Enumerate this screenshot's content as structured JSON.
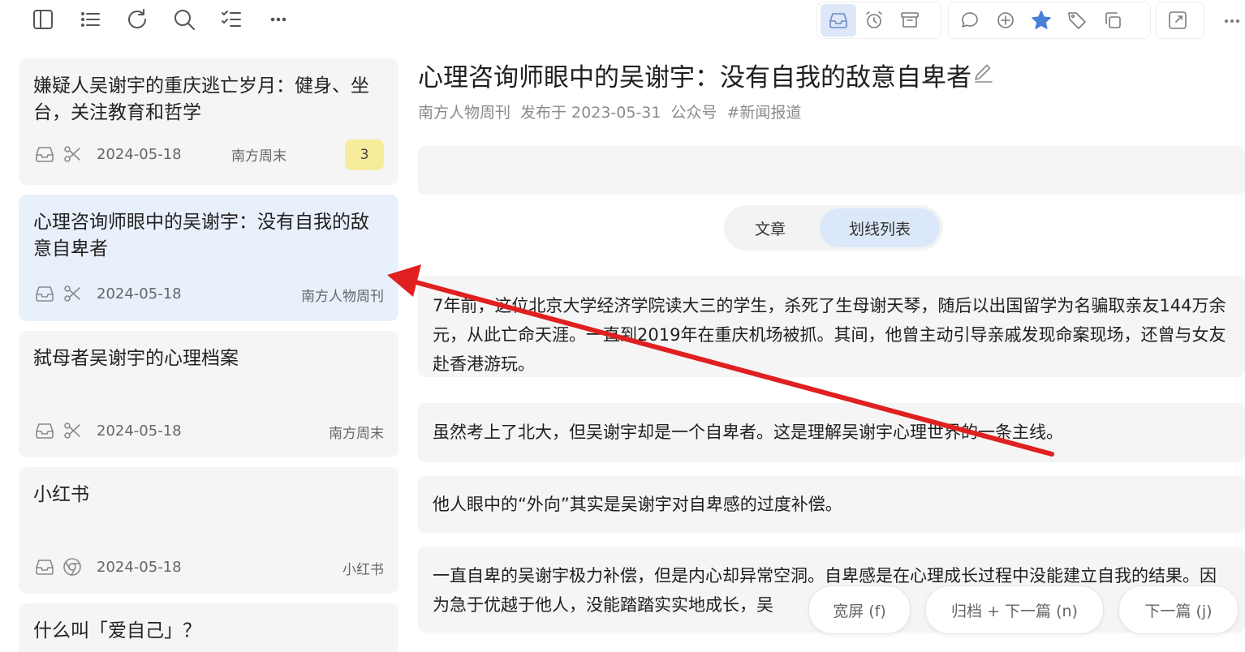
{
  "list": {
    "cards": [
      {
        "title": "嫌疑人吴谢宇的重庆逃亡岁月：健身、坐台，关注教育和哲学",
        "date": "2024-05-18",
        "source": "南方周末",
        "badge": "3",
        "icon2": "scissors-icon"
      },
      {
        "title": "心理咨询师眼中的吴谢宇：没有自我的敌意自卑者",
        "date": "2024-05-18",
        "source": "南方人物周刊",
        "icon2": "scissors-icon"
      },
      {
        "title": "弑母者吴谢宇的心理档案",
        "date": "2024-05-18",
        "source": "南方周末",
        "icon2": "scissors-icon"
      },
      {
        "title": "小红书",
        "date": "2024-05-18",
        "source": "小红书",
        "icon2": "chrome-icon"
      },
      {
        "title": "什么叫「爱自己」？"
      }
    ]
  },
  "article": {
    "title": "心理咨询师眼中的吴谢宇：没有自我的敌意自卑者",
    "meta": {
      "source": "南方人物周刊",
      "published": "发布于 2023-05-31",
      "type": "公众号",
      "tag": "#新闻报道"
    }
  },
  "tabs": {
    "article": "文章",
    "highlights": "划线列表"
  },
  "highlights": [
    "7年前，这位北京大学经济学院读大三的学生，杀死了生母谢天琴，随后以出国留学为名骗取亲友144万余元，从此亡命天涯。一直到2019年在重庆机场被抓。其间，他曾主动引导亲戚发现命案现场，还曾与女友赴香港游玩。",
    "虽然考上了北大，但吴谢宇却是一个自卑者。这是理解吴谢宇心理世界的一条主线。",
    "他人眼中的“外向”其实是吴谢宇对自卑感的过度补偿。",
    "一直自卑的吴谢宇极力补偿，但是内心却异常空洞。自卑感是在心理成长过程中没能建立自我的结果。因为急于优越于他人，没能踏踏实实地成长，吴"
  ],
  "buttons": {
    "wide": "宽屏 (f)",
    "archive_next": "归档 + 下一篇 (n)",
    "next": "下一篇 (j)"
  },
  "colors": {
    "arrow": "#e02020",
    "selected_card": "#e8f0fc",
    "highlight_bar": "#f4ea8e",
    "badge": "#f7ec9c",
    "star": "#4a7fd8"
  }
}
